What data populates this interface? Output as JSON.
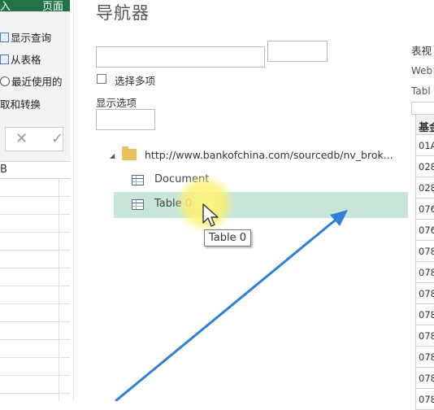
{
  "excel": {
    "ribbon_tabs": [
      "入",
      "页面"
    ],
    "commands": [
      {
        "label": "显示查询",
        "icon": "table-icon"
      },
      {
        "label": "从表格",
        "icon": "table-icon"
      },
      {
        "label": "最近使用的",
        "icon": "clock-icon"
      },
      {
        "label": "取和转换",
        "icon": ""
      }
    ],
    "formula_bar": {
      "cancel": "✕",
      "confirm": "✓"
    },
    "column_header": "B"
  },
  "navigator": {
    "title": "导航器",
    "search_value": "",
    "select_multiple_label": "选择多项",
    "select_multiple_checked": false,
    "display_options_label": "显示选项",
    "tree": {
      "root_url": "http://www.bankofchina.com/sourcedb/nv_brok...",
      "items": [
        {
          "label": "Document",
          "icon": "table-icon"
        },
        {
          "label": "Table 0",
          "icon": "table-icon",
          "selected": true
        }
      ]
    },
    "tooltip": "Table 0",
    "highlight_color": "#c7e6d8"
  },
  "preview": {
    "title": "表视",
    "subtitle": "Web",
    "subtitle2": "Tabl",
    "column_header": "基金",
    "rows": [
      "01A",
      "028",
      "028",
      "076",
      "076",
      "078",
      "078",
      "078",
      "078",
      "078",
      "078",
      "078",
      "078"
    ]
  },
  "annotation": {
    "arrow_color": "#2f7fd6"
  }
}
